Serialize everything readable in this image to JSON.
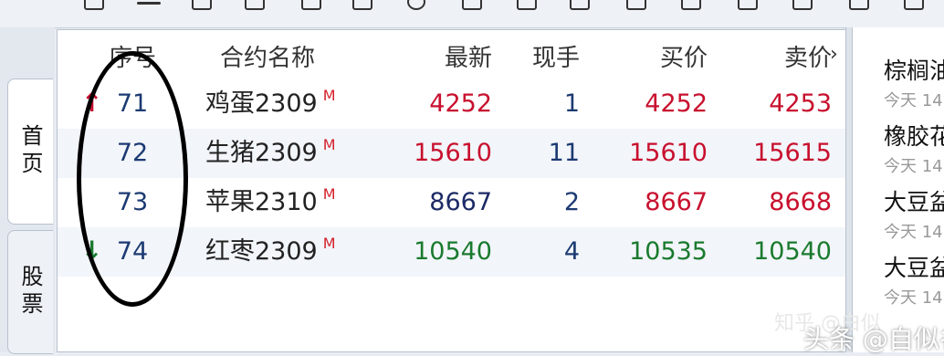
{
  "sidebar": {
    "tabs": [
      {
        "label": "首页",
        "active": true
      },
      {
        "label": "股票",
        "active": false
      }
    ]
  },
  "quote_table": {
    "headers": {
      "seq": "序号",
      "name": "合约名称",
      "last": "最新",
      "volume": "现手",
      "bid": "买价",
      "ask": "卖价"
    },
    "rows": [
      {
        "seq": "71",
        "name": "鸡蛋2309",
        "mark": "M",
        "last": "4252",
        "last_color": "#c8102e",
        "volume": "1",
        "bid": "4252",
        "bid_color": "#c8102e",
        "ask": "4253",
        "ask_color": "#c8102e",
        "direction": "up"
      },
      {
        "seq": "72",
        "name": "生猪2309",
        "mark": "M",
        "last": "15610",
        "last_color": "#c8102e",
        "volume": "11",
        "bid": "15610",
        "bid_color": "#c8102e",
        "ask": "15615",
        "ask_color": "#c8102e",
        "direction": "none"
      },
      {
        "seq": "73",
        "name": "苹果2310",
        "mark": "M",
        "last": "8667",
        "last_color": "#1c2a66",
        "volume": "2",
        "bid": "8667",
        "bid_color": "#c8102e",
        "ask": "8668",
        "ask_color": "#c8102e",
        "direction": "none"
      },
      {
        "seq": "74",
        "name": "红枣2309",
        "mark": "M",
        "last": "10540",
        "last_color": "#1a7a2e",
        "volume": "4",
        "bid": "10535",
        "bid_color": "#1a7a2e",
        "ask": "10540",
        "ask_color": "#1a7a2e",
        "direction": "down"
      }
    ],
    "colors": {
      "up": "#c8102e",
      "down": "#1a7a2e",
      "flat": "#1c2a66"
    }
  },
  "news": {
    "items": [
      {
        "title": "棕榈油",
        "time": "今天 14"
      },
      {
        "title": "橡胶花",
        "time": "今天 14"
      },
      {
        "title": "大豆盆",
        "time": "今天 14"
      },
      {
        "title": "大豆盆",
        "time": "今天 14"
      }
    ]
  },
  "watermarks": {
    "zhihu": "知乎 @白似",
    "toutiao": "头条 @自似谷"
  }
}
